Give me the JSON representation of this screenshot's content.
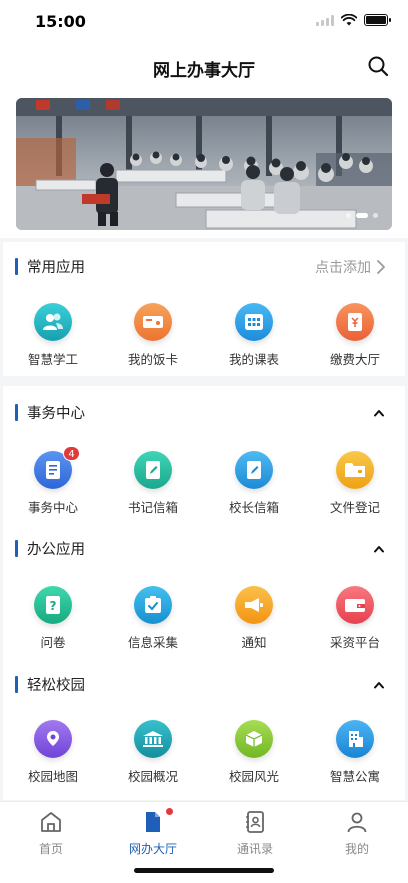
{
  "status_bar": {
    "time": "15:00"
  },
  "header": {
    "title": "网上办事大厅"
  },
  "banner": {
    "slides": 3,
    "active_slide": 2
  },
  "sections": {
    "common": {
      "title": "常用应用",
      "action_label": "点击添加",
      "apps": [
        {
          "label": "智慧学工",
          "icon": "users-icon",
          "color": "#23b3c1"
        },
        {
          "label": "我的饭卡",
          "icon": "card-icon",
          "color": "#f08a3c"
        },
        {
          "label": "我的课表",
          "icon": "grid-icon",
          "color": "#2e9ee8"
        },
        {
          "label": "缴费大厅",
          "icon": "payment-icon",
          "color": "#f07a4a"
        }
      ]
    },
    "affairs": {
      "title": "事务中心",
      "apps": [
        {
          "label": "事务中心",
          "icon": "book-icon",
          "color": "#3f7be6",
          "badge": "4"
        },
        {
          "label": "书记信箱",
          "icon": "edit-note-icon",
          "color": "#2fbfa6"
        },
        {
          "label": "校长信箱",
          "icon": "edit-note-icon",
          "color": "#2ea4e6"
        },
        {
          "label": "文件登记",
          "icon": "folder-icon",
          "color": "#f4b52a"
        }
      ]
    },
    "office": {
      "title": "办公应用",
      "apps": [
        {
          "label": "问卷",
          "icon": "question-icon",
          "color": "#2bc39a"
        },
        {
          "label": "信息采集",
          "icon": "clipboard-check-icon",
          "color": "#2aa8df"
        },
        {
          "label": "通知",
          "icon": "megaphone-icon",
          "color": "#f6a623"
        },
        {
          "label": "采资平台",
          "icon": "wallet-icon",
          "color": "#f05a68"
        }
      ]
    },
    "campus": {
      "title": "轻松校园",
      "apps": [
        {
          "label": "校园地图",
          "icon": "location-icon",
          "color": "#8b5de8"
        },
        {
          "label": "校园概况",
          "icon": "building-icon",
          "color": "#22a7b5"
        },
        {
          "label": "校园风光",
          "icon": "cube-icon",
          "color": "#8fcf3a"
        },
        {
          "label": "智慧公寓",
          "icon": "apartment-icon",
          "color": "#2f9ee6"
        }
      ]
    }
  },
  "tabbar": {
    "active": "网办大厅",
    "items": [
      {
        "label": "首页",
        "icon": "home-icon"
      },
      {
        "label": "网办大厅",
        "icon": "document-icon"
      },
      {
        "label": "通讯录",
        "icon": "contacts-icon"
      },
      {
        "label": "我的",
        "icon": "person-icon"
      }
    ]
  }
}
